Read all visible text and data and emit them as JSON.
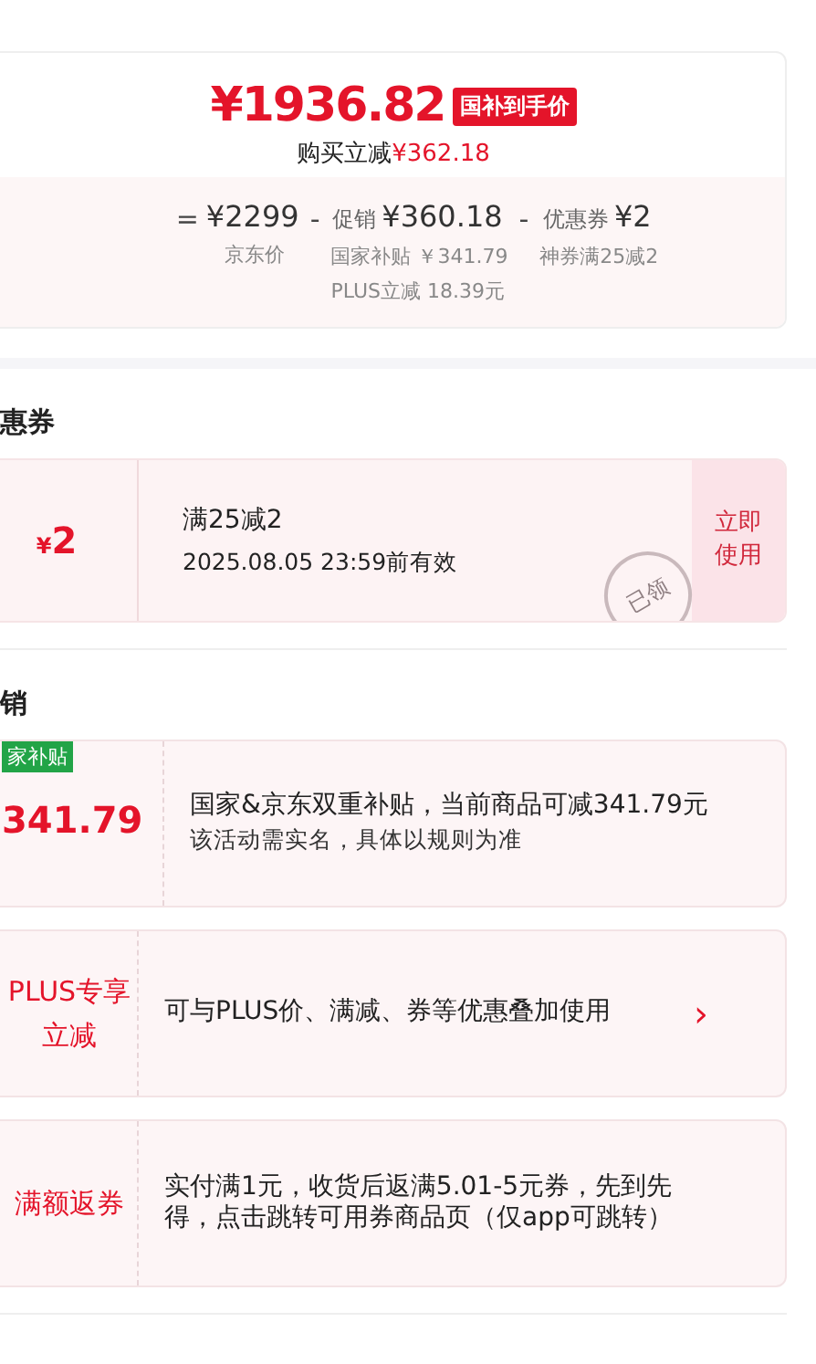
{
  "price_card": {
    "final_price": "¥1936.82",
    "badge": "国补到手价",
    "saving_label": "购买立减",
    "saving_amount": "¥362.18",
    "breakdown": [
      {
        "operator": "=",
        "amount": "¥2299",
        "notes": [
          "京东价"
        ]
      },
      {
        "operator": "-",
        "amount_label": "促销",
        "amount": "¥360.18",
        "notes": [
          "国家补贴 ￥341.79",
          "PLUS立减 18.39元"
        ]
      },
      {
        "operator": "-",
        "amount_label": "优惠券",
        "amount": "¥2",
        "notes": [
          "神券满25减2"
        ]
      }
    ]
  },
  "coupons_section": {
    "heading": "惠券",
    "coupons": [
      {
        "currency": "¥",
        "value": "2",
        "condition": "满25减2",
        "validity": "2025.08.05 23:59前有效",
        "stamp": "已领",
        "action": "立即使用"
      }
    ]
  },
  "promotions_section": {
    "heading": "销",
    "promotions": [
      {
        "kind": "amount",
        "tag": "家补贴",
        "title": "341.79",
        "lines": [
          "国家&京东双重补贴，当前商品可减341.79元",
          "该活动需实名，具体以规则为准"
        ]
      },
      {
        "kind": "label",
        "title": "PLUS专享立减",
        "lines": [
          "可与PLUS价、满减、券等优惠叠加使用"
        ],
        "arrow": "›"
      },
      {
        "kind": "label",
        "title": "满额返券",
        "lines": [
          "实付满1元，收货后返满5.01-5元券，先到先得，点击跳转可用券商品页（仅app可跳转）"
        ]
      }
    ]
  }
}
